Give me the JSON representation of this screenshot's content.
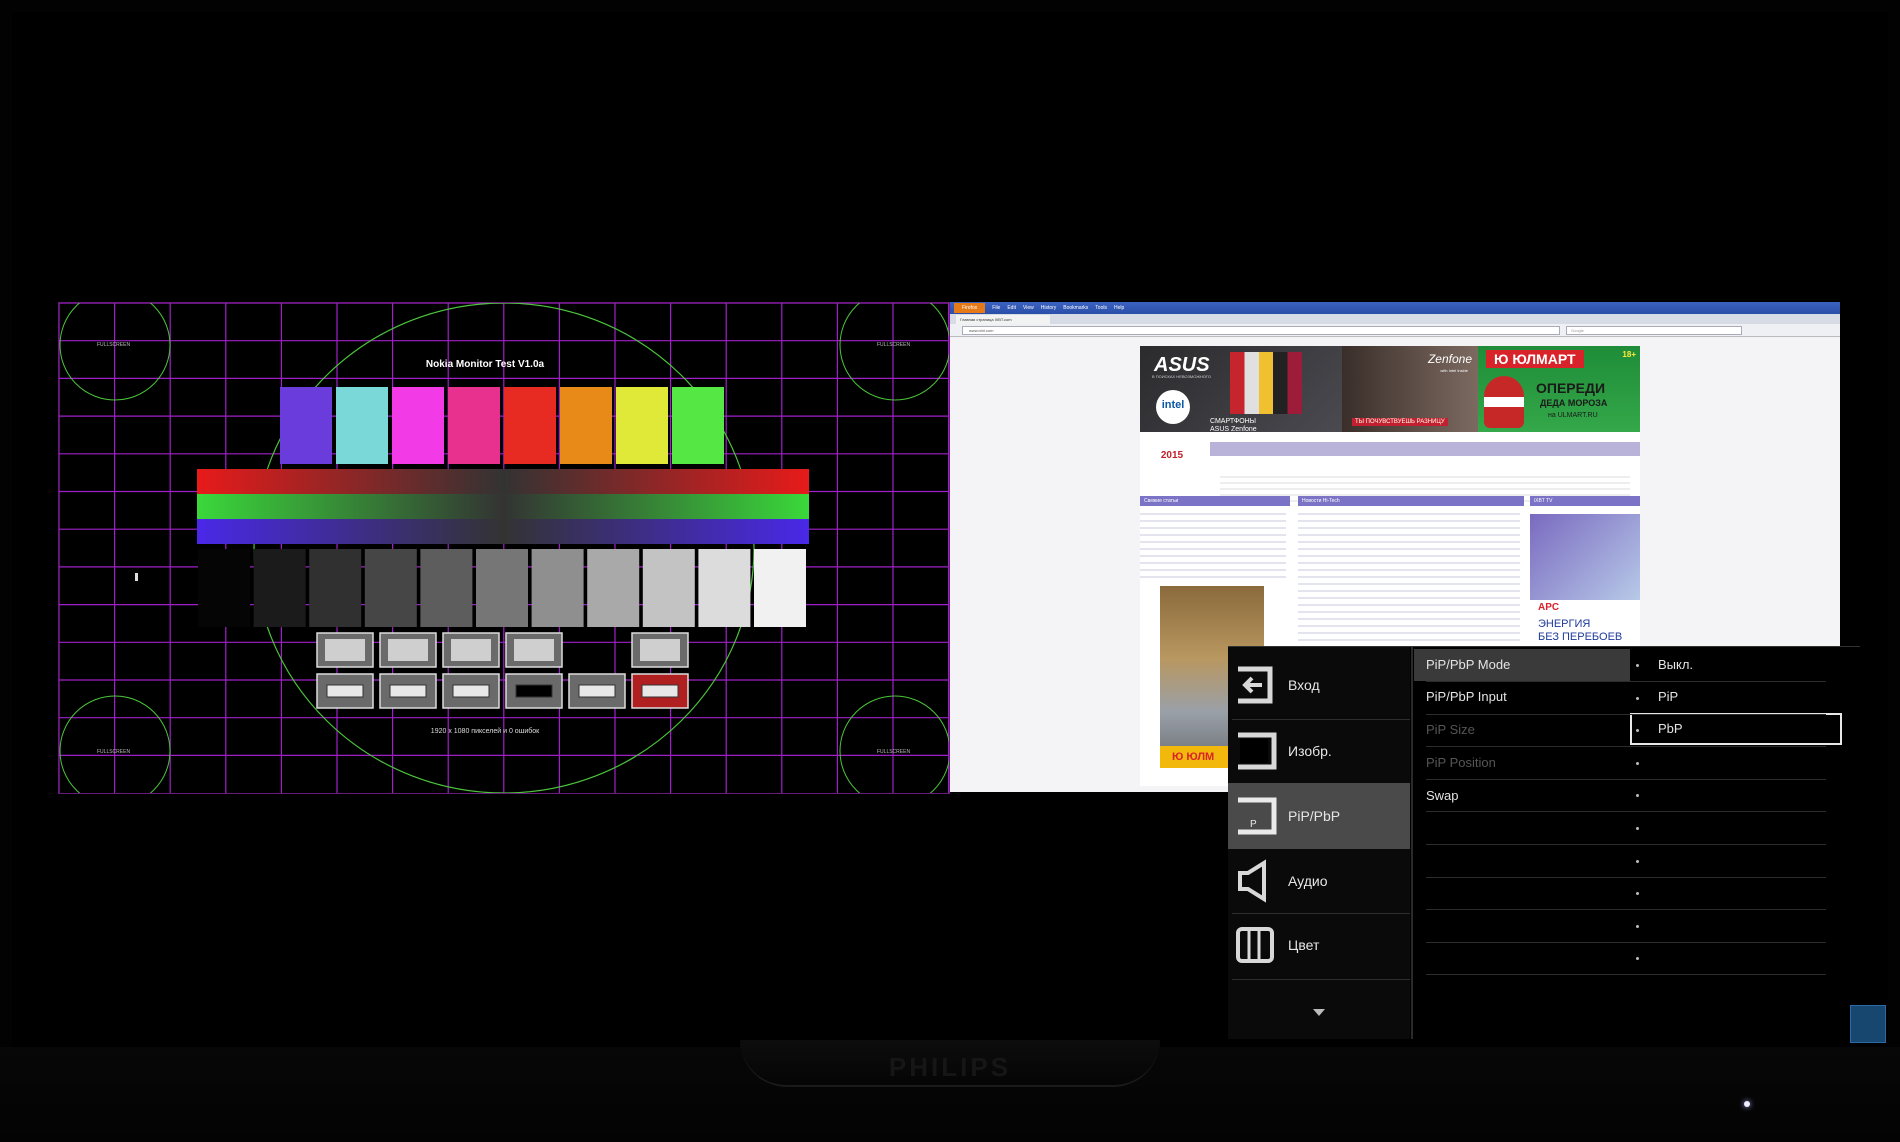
{
  "monitor": {
    "brand": "PHILIPS"
  },
  "left_pip": {
    "title": "Nokia Monitor Test V1.0a",
    "resolution_text": "1920 x 1080 пикселей и 0 ошибок",
    "corner_label": "FULLSCREEN",
    "color_bars": [
      "#6a3cdb",
      "#7ad8d8",
      "#f23ae6",
      "#e8308e",
      "#e72a22",
      "#e88a18",
      "#e0e838",
      "#55e844"
    ],
    "gray_steps": [
      "#050505",
      "#1b1b1b",
      "#303030",
      "#464646",
      "#5d5d5d",
      "#767676",
      "#8f8f8f",
      "#a9a9a9",
      "#c3c3c3",
      "#dcdcdc",
      "#f1f1f1"
    ]
  },
  "right_pip": {
    "browser_name": "Firefox",
    "menu": [
      "File",
      "Edit",
      "View",
      "History",
      "Bookmarks",
      "Tools",
      "Help"
    ],
    "tab_title": "Главная страница iXBT.com",
    "url": "www.ixbt.com",
    "search_placeholder": "Google",
    "ad_asus": {
      "logo": "ASUS",
      "tagline": "В ПОИСКАХ НЕВОЗМОЖНОГО",
      "intel": "intel",
      "intel_sub": "inside",
      "line1": "СМАРТФОНЫ",
      "line2": "ASUS Zenfone"
    },
    "ad_zenfone": {
      "logo": "Zenfone",
      "sub": "with Intel Inside",
      "cta": "ТЫ ПОЧУВСТВУЕШЬ РАЗНИЦУ"
    },
    "ad_ulmart": {
      "logo": "Ю ЮЛМАРТ",
      "age": "18+",
      "line1": "ОПЕРЕДИ",
      "line2": "ДЕДА МОРОЗА",
      "url": "на ULMART.RU"
    },
    "logo_year": "2015",
    "col_heads": [
      "Свежие статьи",
      "Новости Hi-Tech",
      "iXBT TV"
    ],
    "ulmart_mini": "Ю ЮЛМ",
    "apc": {
      "logo": "APC",
      "line1": "ЭНЕРГИЯ",
      "line2": "БЕЗ ПЕРЕБОЕВ"
    }
  },
  "osd": {
    "main_menu": [
      {
        "label": "Вход",
        "icon": "input-arrow-icon"
      },
      {
        "label": "Изобр.",
        "icon": "picture-icon"
      },
      {
        "label": "PiP/PbP",
        "icon": "pip-icon",
        "active": true
      },
      {
        "label": "Аудио",
        "icon": "speaker-icon"
      },
      {
        "label": "Цвет",
        "icon": "color-icon"
      }
    ],
    "submenu": [
      {
        "label": "PiP/PbP Mode",
        "state": "active"
      },
      {
        "label": "PiP/PbP Input",
        "state": "normal"
      },
      {
        "label": "PiP Size",
        "state": "disabled"
      },
      {
        "label": "PiP Position",
        "state": "disabled"
      },
      {
        "label": "Swap",
        "state": "normal"
      }
    ],
    "options": [
      "Выкл.",
      "PiP",
      "PbP"
    ],
    "selected_option": "PbP"
  }
}
